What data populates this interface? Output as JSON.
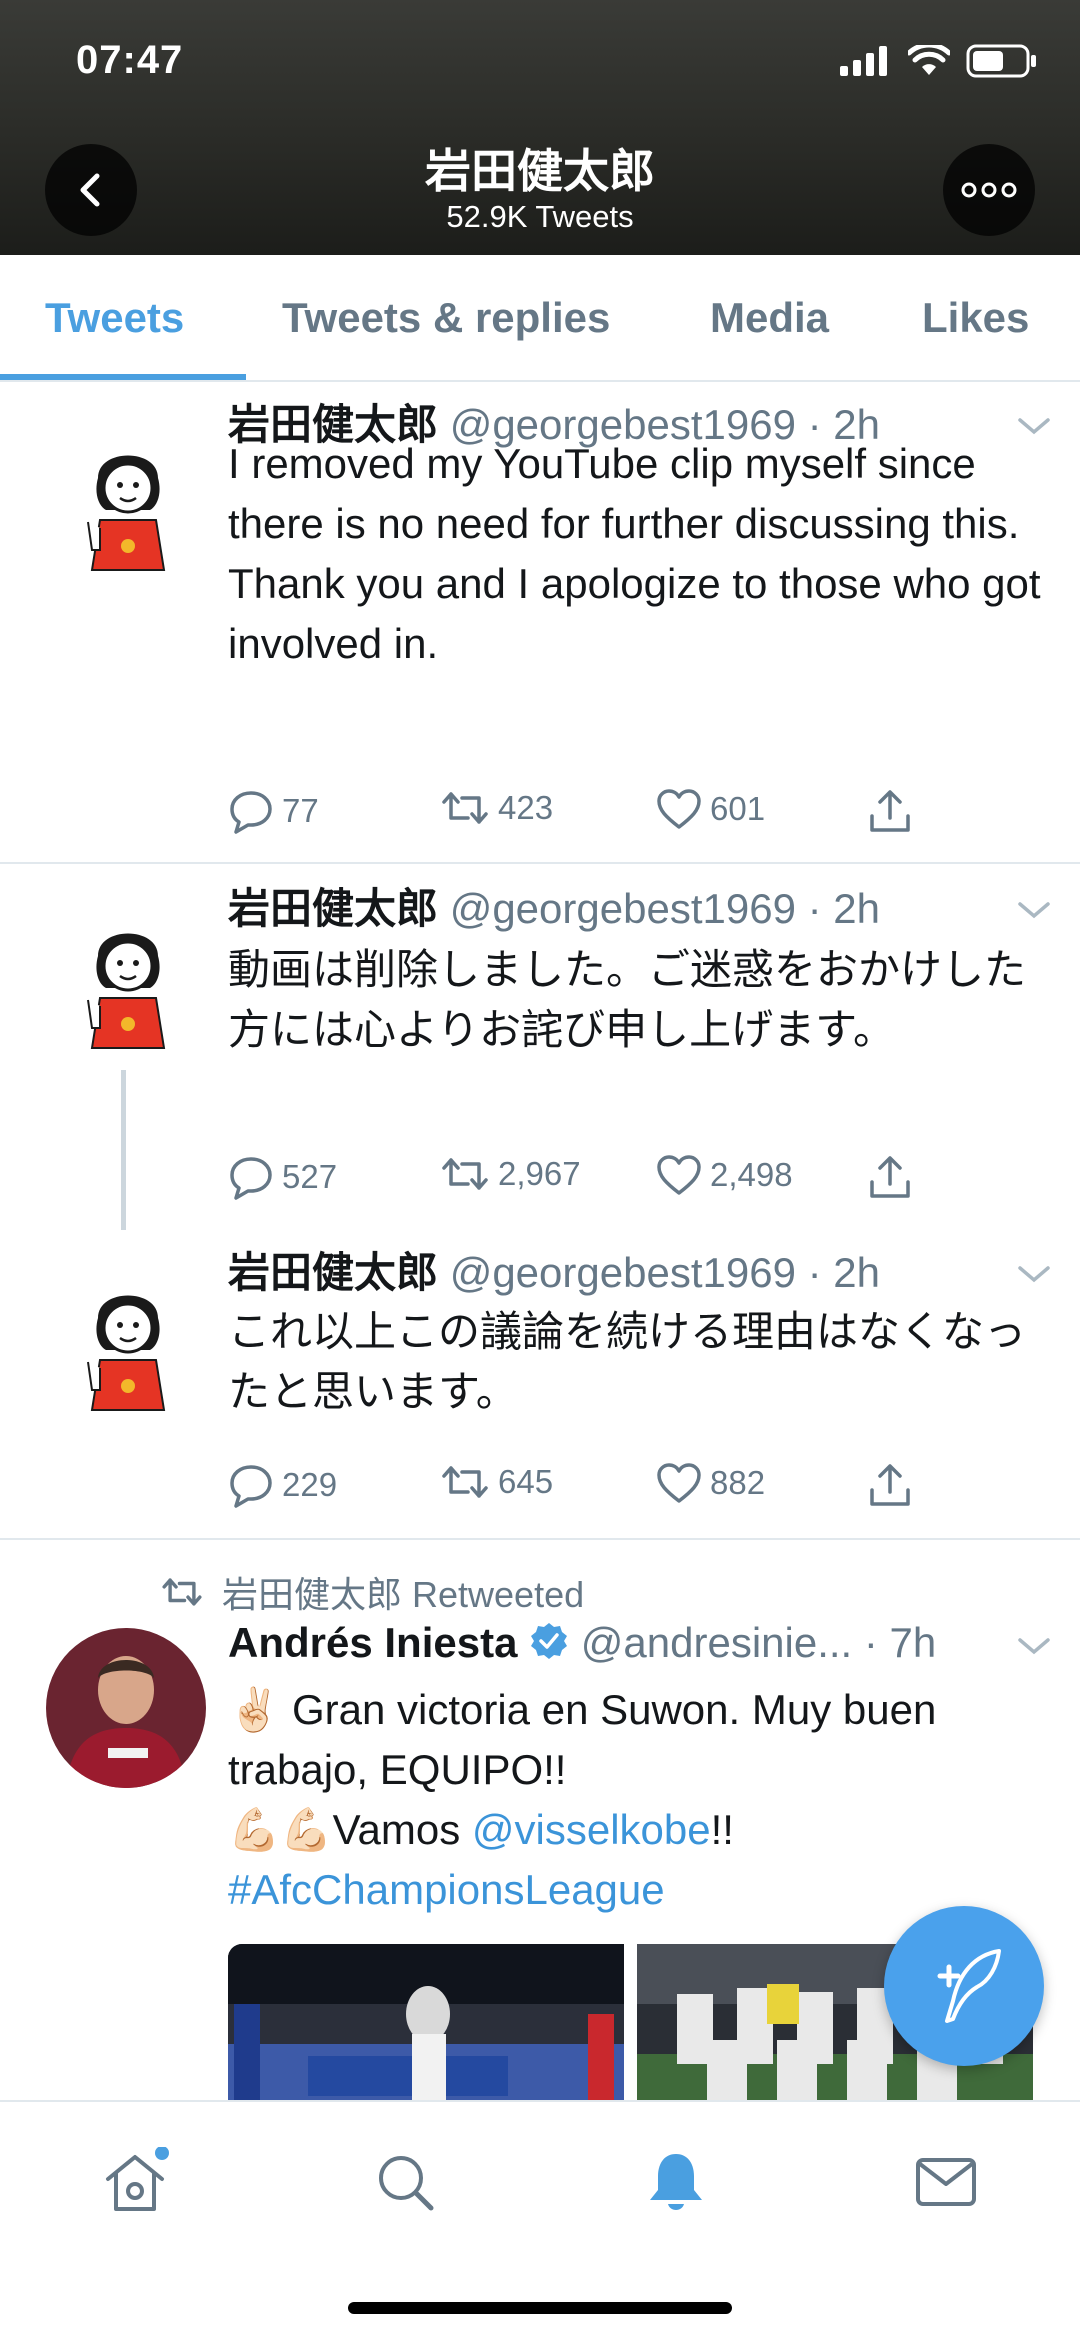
{
  "status_bar": {
    "time": "07:47"
  },
  "header": {
    "title": "岩田健太郎",
    "subtitle": "52.9K Tweets"
  },
  "tabs": [
    {
      "label": "Tweets",
      "active": true
    },
    {
      "label": "Tweets & replies",
      "active": false
    },
    {
      "label": "Media",
      "active": false
    },
    {
      "label": "Likes",
      "active": false
    }
  ],
  "tweets": [
    {
      "name": "岩田健太郎",
      "handle": "@georgebest1969",
      "time": "· 2h",
      "text": "I removed my YouTube clip myself since there is no need for further discussing this. Thank you and I apologize to those who got involved in.",
      "replies": "77",
      "retweets": "423",
      "likes": "601"
    },
    {
      "name": "岩田健太郎",
      "handle": "@georgebest1969",
      "time": "· 2h",
      "text": "動画は削除しました。ご迷惑をおかけした方には心よりお詫び申し上げます。",
      "replies": "527",
      "retweets": "2,967",
      "likes": "2,498"
    },
    {
      "name": "岩田健太郎",
      "handle": "@georgebest1969",
      "time": "· 2h",
      "text": "これ以上この議論を続ける理由はなくなったと思います。",
      "replies": "229",
      "retweets": "645",
      "likes": "882"
    }
  ],
  "retweet": {
    "context": "岩田健太郎 Retweeted",
    "name": "Andrés Iniesta",
    "handle": "@andresinie...",
    "time": "· 7h",
    "line1": "Gran victoria en Suwon. Muy buen trabajo, EQUIPO!!",
    "line2_text": "Vamos",
    "mention": "@visselkobe",
    "line2_end": "!!",
    "hashtag": "#AfcChampionsLeague"
  },
  "colors": {
    "accent": "#4a9fe0",
    "secondary_text": "#657786",
    "divider": "#e1e8ed"
  },
  "icons": {
    "nav": [
      "home-icon",
      "search-icon",
      "notifications-bell-icon",
      "messages-envelope-icon"
    ],
    "fab": "compose-tweet-icon"
  }
}
